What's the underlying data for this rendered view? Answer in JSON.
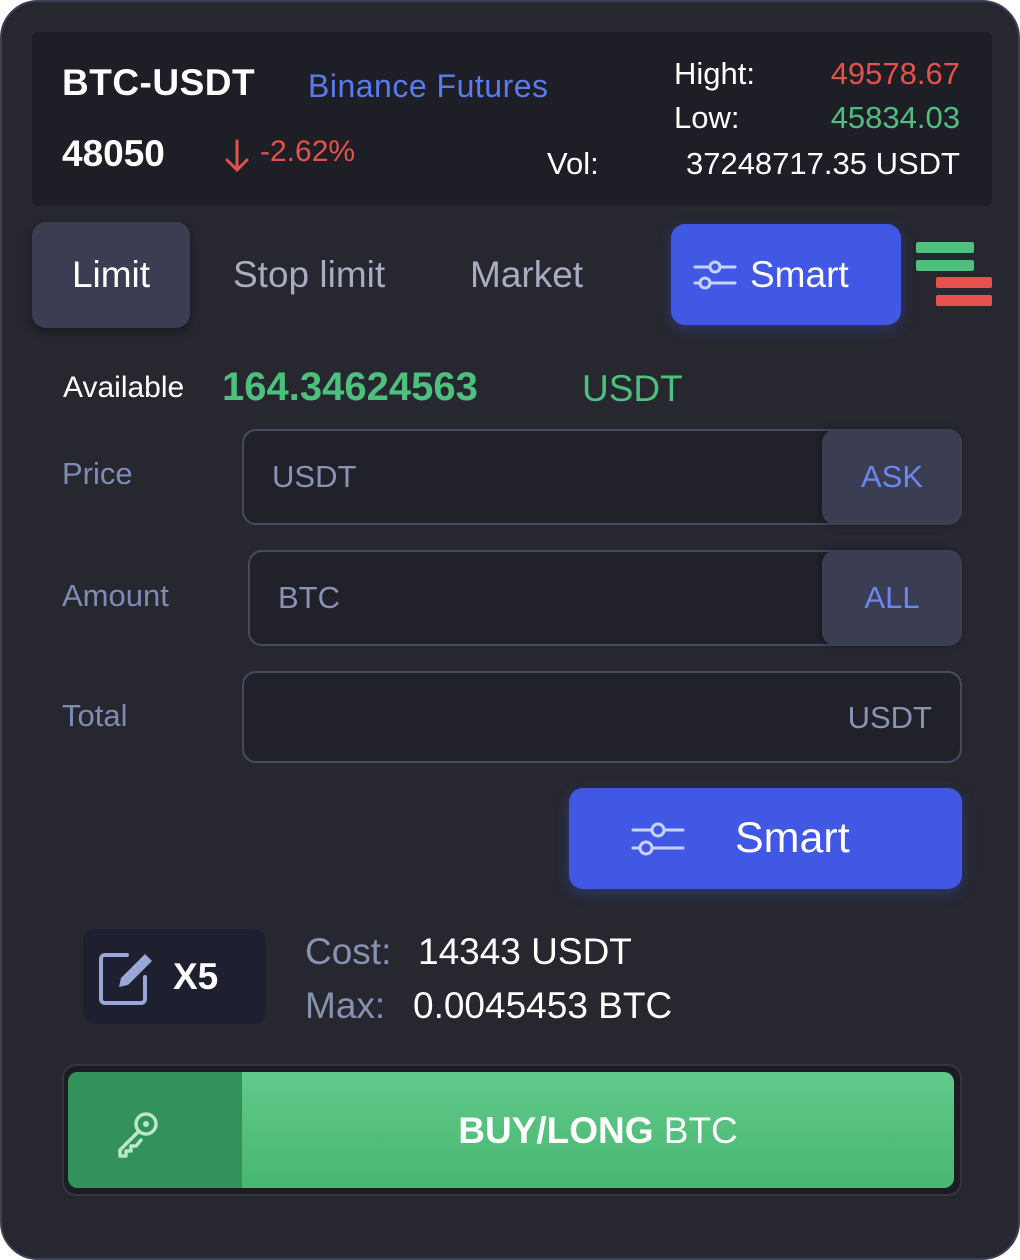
{
  "header": {
    "pair": "BTC-USDT",
    "exchange": "Binance Futures",
    "last_price": "48050",
    "change": "-2.62%",
    "high_label": "Hight:",
    "high_value": "49578.67",
    "low_label": "Low:",
    "low_value": "45834.03",
    "vol_label": "Vol:",
    "vol_value": "37248717.35 USDT"
  },
  "order_tabs": {
    "limit": "Limit",
    "stop_limit": "Stop limit",
    "market": "Market",
    "active": "Limit"
  },
  "smart_top": {
    "label": "Smart"
  },
  "available": {
    "label": "Available",
    "value": "164.34624563",
    "unit": "USDT"
  },
  "form": {
    "price_label": "Price",
    "price_placeholder": "USDT",
    "price_button": "ASK",
    "amount_label": "Amount",
    "amount_placeholder": "BTC",
    "amount_button": "ALL",
    "total_label": "Total",
    "total_unit": "USDT"
  },
  "smart_bottom": {
    "label": "Smart"
  },
  "leverage": {
    "label": "X5"
  },
  "summary": {
    "cost_label": "Cost:",
    "cost_value": "14343 USDT",
    "max_label": "Max:",
    "max_value": "0.0045453 BTC"
  },
  "buy": {
    "action": "BUY/LONG",
    "asset": "BTC"
  },
  "colors": {
    "accent": "#4158e4",
    "up": "#4ec07e",
    "down": "#e5514c",
    "panel": "#26272f"
  }
}
